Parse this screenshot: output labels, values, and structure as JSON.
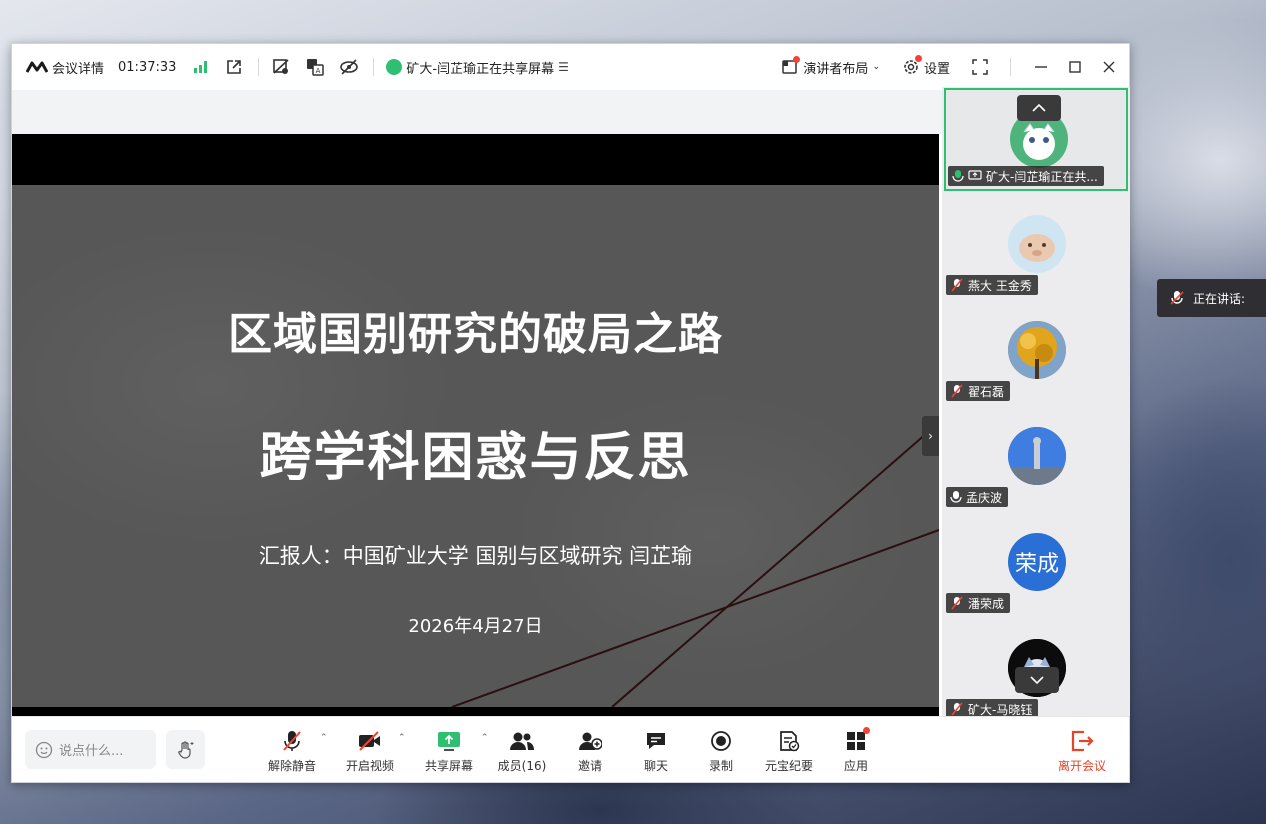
{
  "titlebar": {
    "meeting_details": "会议详情",
    "duration": "01:37:33",
    "sharing_status": "矿大-闫芷瑜正在共享屏幕",
    "layout_label": "演讲者布局",
    "settings_label": "设置"
  },
  "slide": {
    "title_line1": "区域国别研究的破局之路",
    "title_line2": "跨学科困惑与反思",
    "author": "汇报人：中国矿业大学 国别与区域研究 闫芷瑜",
    "date": "2026年4月27日",
    "annotate_label": "批注"
  },
  "participants": [
    {
      "name": "矿大-闫芷瑜正在共...",
      "mic": "on",
      "avatar": "cartoon-avatar"
    },
    {
      "name": "燕大 王金秀",
      "mic": "muted",
      "avatar": "animal-avatar"
    },
    {
      "name": "翟石磊",
      "mic": "muted",
      "avatar": "tree-avatar"
    },
    {
      "name": "孟庆波",
      "mic": "on",
      "avatar": "statue-avatar"
    },
    {
      "name": "潘荣成",
      "mic": "muted",
      "avatar_text": "荣成"
    },
    {
      "name": "矿大-马晓钰",
      "mic": "muted",
      "avatar": "dark-avatar"
    }
  ],
  "side_panel": {
    "speaking_label": "正在讲话:"
  },
  "toolbar": {
    "chat_placeholder": "说点什么...",
    "unmute": "解除静音",
    "start_video": "开启视频",
    "share_screen": "共享屏幕",
    "members": "成员(16)",
    "invite": "邀请",
    "chat": "聊天",
    "record": "录制",
    "ai_minutes": "元宝纪要",
    "apps": "应用",
    "leave": "离开会议"
  },
  "colors": {
    "accent_green": "#2fbf71",
    "leave_red": "#e5432a",
    "notification_dot": "#f04438",
    "slide_background": "#575757"
  }
}
